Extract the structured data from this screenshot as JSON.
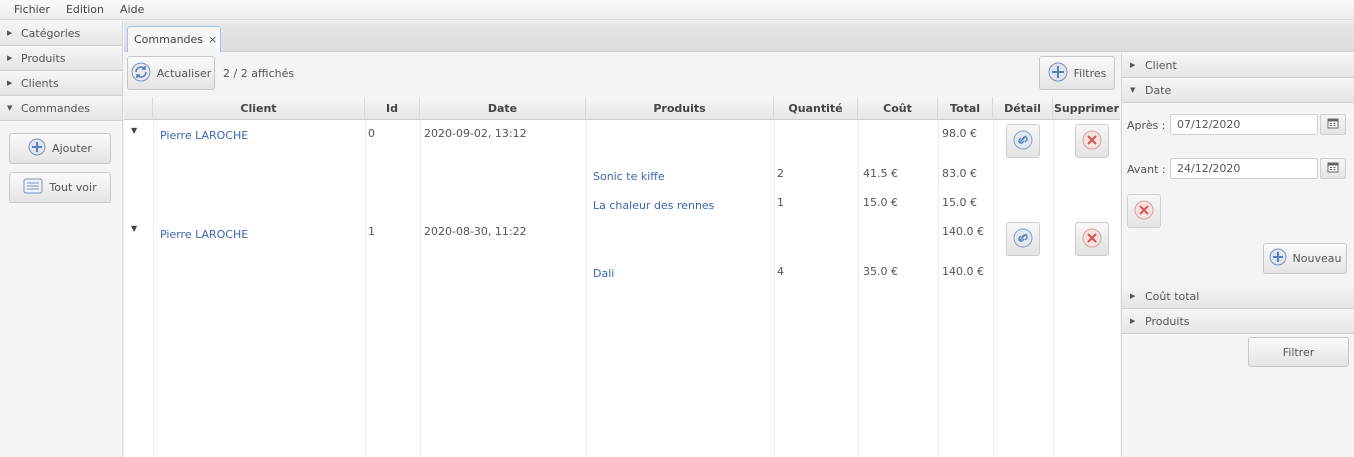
{
  "menu": [
    "Fichier",
    "Edition",
    "Aide"
  ],
  "left_accordion": {
    "sections": [
      "Catégories",
      "Produits",
      "Clients",
      "Commandes"
    ],
    "buttons": {
      "add": "Ajouter",
      "show_all": "Tout voir"
    }
  },
  "tab": {
    "label": "Commandes",
    "close": "×"
  },
  "toolbar": {
    "refresh": "Actualiser",
    "count": "2 / 2 affichés",
    "filters": "Filtres"
  },
  "table": {
    "headers": [
      "Client",
      "Id",
      "Date",
      "Produits",
      "Quantité",
      "Coût",
      "Total",
      "Détail",
      "Supprimer"
    ],
    "orders": [
      {
        "client": "Pierre LAROCHE",
        "id": "0",
        "date": "2020-09-02, 13:12",
        "total": "98.0 €",
        "items": [
          {
            "product": "Sonic te kiffe",
            "qty": "2",
            "cost": "41.5 €",
            "total": "83.0 €"
          },
          {
            "product": "La chaleur des rennes",
            "qty": "1",
            "cost": "15.0 €",
            "total": "15.0 €"
          }
        ]
      },
      {
        "client": "Pierre LAROCHE",
        "id": "1",
        "date": "2020-08-30, 11:22",
        "total": "140.0 €",
        "items": [
          {
            "product": "Dali",
            "qty": "4",
            "cost": "35.0 €",
            "total": "140.0 €"
          }
        ]
      }
    ]
  },
  "filters_pane": {
    "sections": {
      "client": "Client",
      "date": "Date",
      "cost": "Coût total",
      "products": "Produits"
    },
    "after_label": "Après :",
    "after_value": "07/12/2020",
    "before_label": "Avant :",
    "before_value": "24/12/2020",
    "new_button": "Nouveau",
    "filter_button": "Filtrer"
  },
  "colors": {
    "link": "#3a66b0",
    "delete_red": "#d9534f",
    "detail_blue": "#5b7fb8",
    "add_blue": "#5a7fb5"
  }
}
